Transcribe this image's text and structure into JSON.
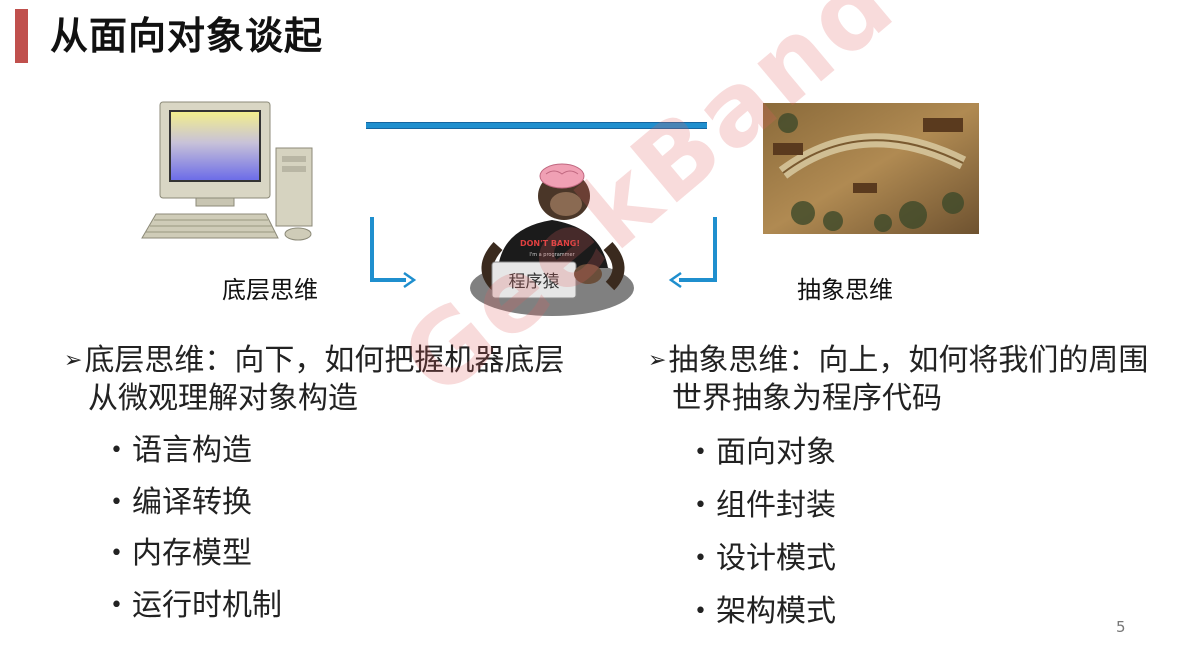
{
  "slide": {
    "title": "从面向对象谈起",
    "page_number": "5",
    "watermark": "GeekBand"
  },
  "figure": {
    "left_caption": "底层思维",
    "right_caption": "抽象思维",
    "monkey_keyboard_text": "程序猿",
    "monkey_shirt_text": "DON'T BANG!",
    "monkey_shirt_subtext": "I'm a programmer"
  },
  "left_column": {
    "heading_line1": "底层思维：向下，如何把握机器底层",
    "heading_line2": "从微观理解对象构造",
    "items": [
      "语言构造",
      "编译转换",
      "内存模型",
      "运行时机制"
    ]
  },
  "right_column": {
    "heading_line1": "抽象思维：向上，如何将我们的周围",
    "heading_line2": "世界抽象为程序代码",
    "items": [
      "面向对象",
      "组件封装",
      "设计模式",
      "架构模式"
    ]
  },
  "colors": {
    "accent_bar": "#c0504d",
    "connector_blue": "#1f8fce"
  }
}
